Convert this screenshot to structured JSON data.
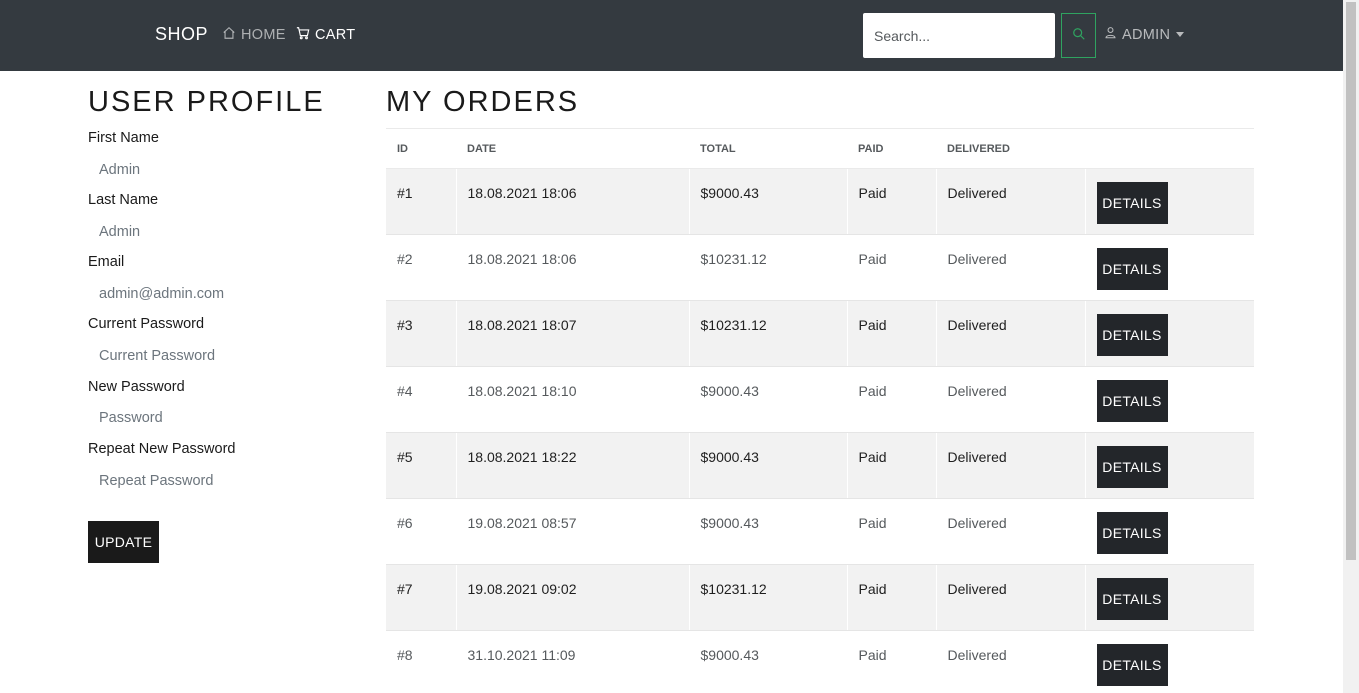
{
  "navbar": {
    "brand": "SHOP",
    "home_label": "HOME",
    "cart_label": "CART",
    "search_placeholder": "Search...",
    "user_label": "ADMIN"
  },
  "profile": {
    "title": "USER PROFILE",
    "fields": [
      {
        "label": "First Name",
        "value": "Admin"
      },
      {
        "label": "Last Name",
        "value": "Admin"
      },
      {
        "label": "Email",
        "value": "admin@admin.com"
      },
      {
        "label": "Current Password",
        "placeholder": "Current Password"
      },
      {
        "label": "New Password",
        "placeholder": "Password"
      },
      {
        "label": "Repeat New Password",
        "placeholder": "Repeat Password"
      }
    ],
    "update_label": "UPDATE"
  },
  "orders": {
    "title": "MY ORDERS",
    "columns": [
      "ID",
      "DATE",
      "TOTAL",
      "PAID",
      "DELIVERED",
      ""
    ],
    "details_label": "DETAILS",
    "rows": [
      {
        "id": "#1",
        "date": "18.08.2021 18:06",
        "total": "$9000.43",
        "paid": "Paid",
        "delivered": "Delivered"
      },
      {
        "id": "#2",
        "date": "18.08.2021 18:06",
        "total": "$10231.12",
        "paid": "Paid",
        "delivered": "Delivered"
      },
      {
        "id": "#3",
        "date": "18.08.2021 18:07",
        "total": "$10231.12",
        "paid": "Paid",
        "delivered": "Delivered"
      },
      {
        "id": "#4",
        "date": "18.08.2021 18:10",
        "total": "$9000.43",
        "paid": "Paid",
        "delivered": "Delivered"
      },
      {
        "id": "#5",
        "date": "18.08.2021 18:22",
        "total": "$9000.43",
        "paid": "Paid",
        "delivered": "Delivered"
      },
      {
        "id": "#6",
        "date": "19.08.2021 08:57",
        "total": "$9000.43",
        "paid": "Paid",
        "delivered": "Delivered"
      },
      {
        "id": "#7",
        "date": "19.08.2021 09:02",
        "total": "$10231.12",
        "paid": "Paid",
        "delivered": "Delivered"
      },
      {
        "id": "#8",
        "date": "31.10.2021 11:09",
        "total": "$9000.43",
        "paid": "Paid",
        "delivered": "Delivered"
      }
    ]
  },
  "colors": {
    "navbar_bg": "#343a40",
    "search_button_border": "#2fa360",
    "button_dark": "#1a1a1a",
    "row_stripe": "#f2f2f2"
  },
  "icons": [
    "home-icon",
    "cart-icon",
    "search-icon",
    "user-icon",
    "chevron-down-icon"
  ]
}
